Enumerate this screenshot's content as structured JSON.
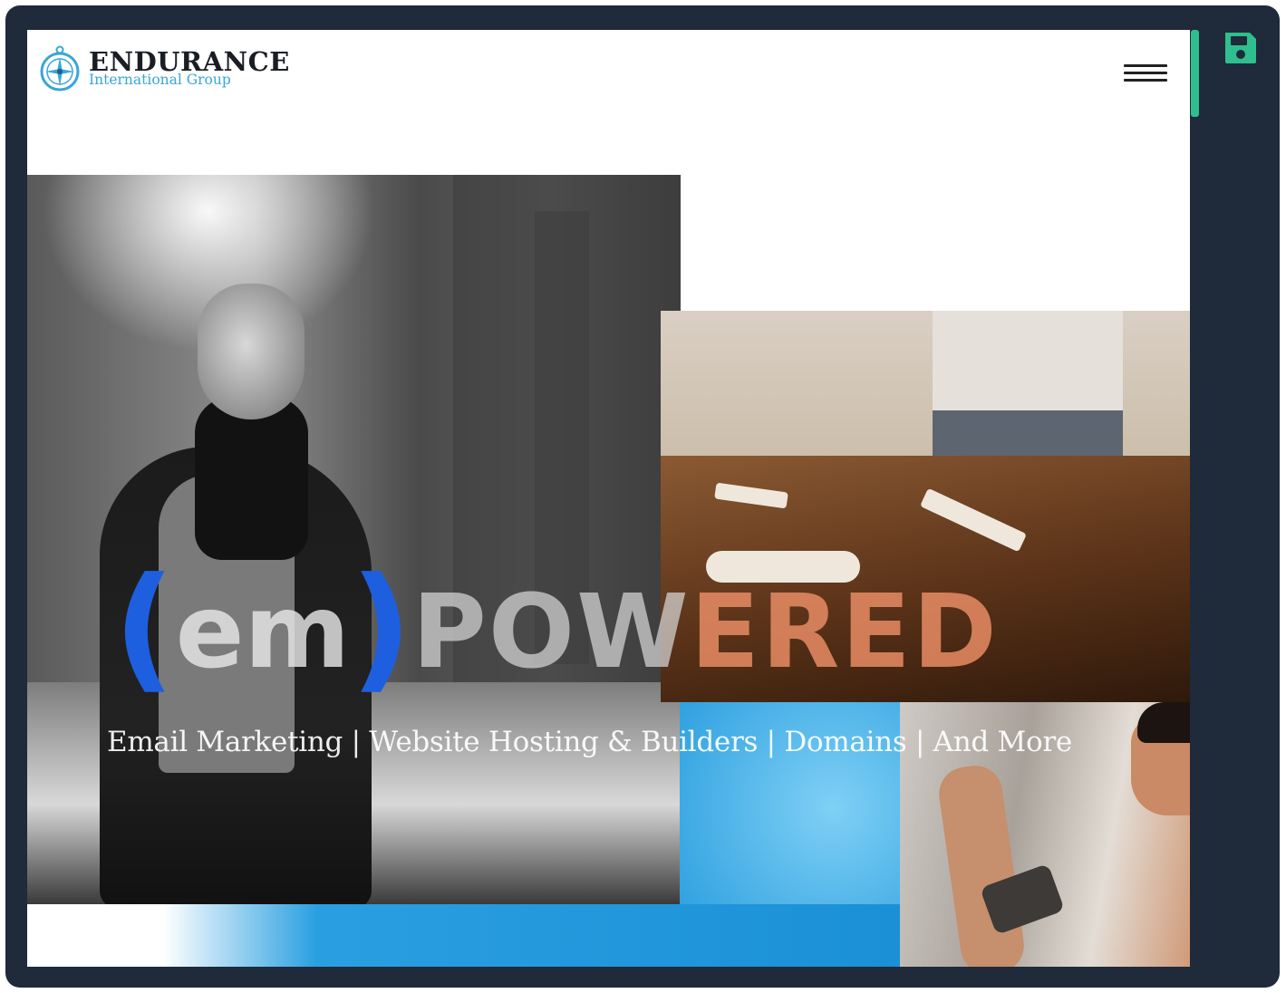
{
  "header": {
    "brand": "ENDURANCE",
    "brand_sub": "International Group"
  },
  "hero": {
    "paren_open": "(",
    "em": "em",
    "paren_close": ")",
    "powered_part1": "POW",
    "powered_part2": "ERED",
    "tagline": "Email Marketing | Website Hosting & Builders | Domains | And More"
  },
  "icons": {
    "save": "floppy-disk",
    "menu": "hamburger",
    "logo": "compass"
  },
  "colors": {
    "frame": "#1f2a3b",
    "scroll_thumb": "#2fbf8e",
    "save_icon": "#2fbf8e",
    "brand_sub": "#3aa6d6",
    "paren": "#1e5fe0"
  }
}
